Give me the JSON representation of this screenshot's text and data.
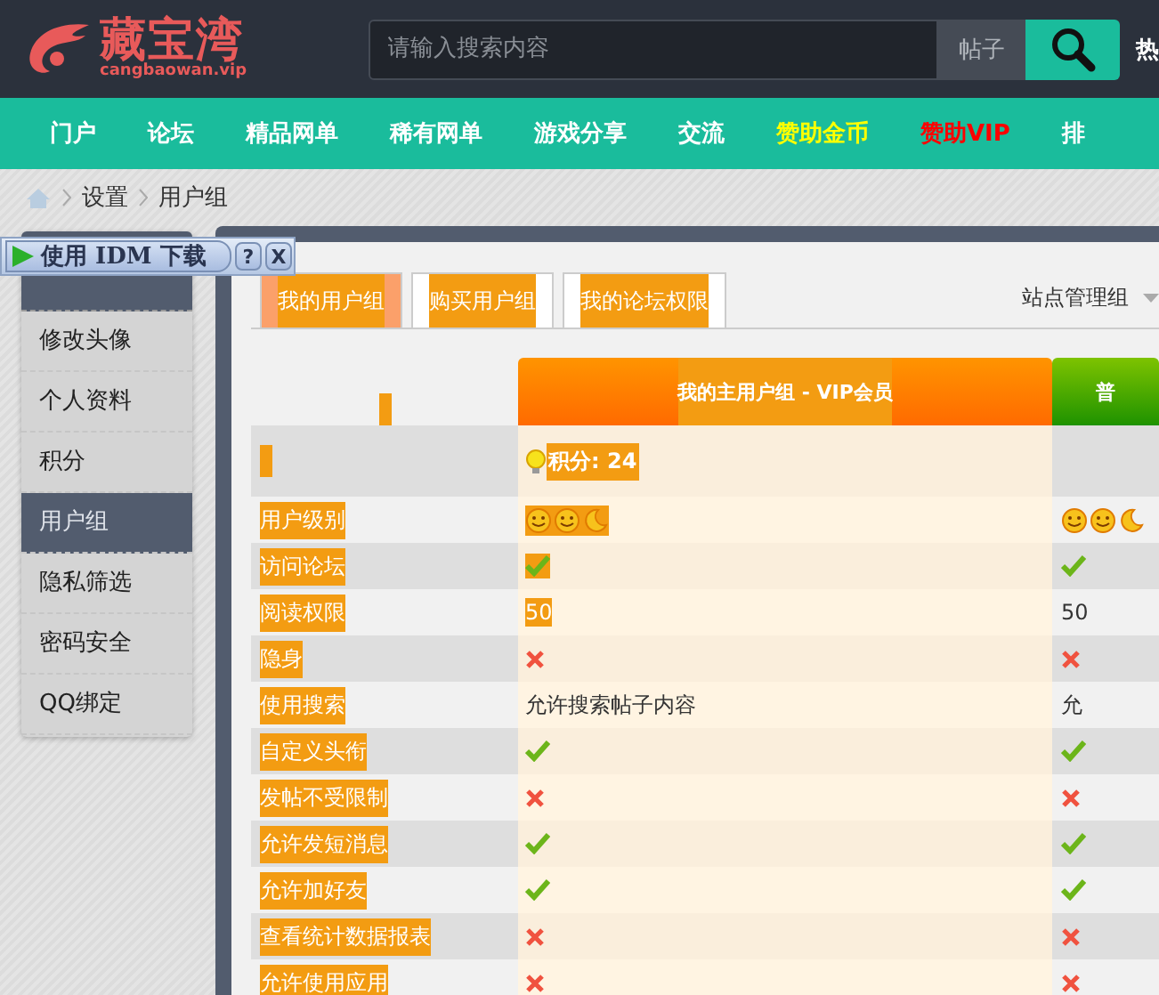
{
  "header": {
    "logo_text": "藏宝湾",
    "logo_domain": "cangbaowan.vip",
    "search": {
      "placeholder": "请输入搜索内容"
    },
    "search_scope": "帖子",
    "hot_label": "热"
  },
  "nav": [
    {
      "label": "门户",
      "kind": "normal"
    },
    {
      "label": "论坛",
      "kind": "normal"
    },
    {
      "label": "精品网单",
      "kind": "normal"
    },
    {
      "label": "稀有网单",
      "kind": "normal"
    },
    {
      "label": "游戏分享",
      "kind": "normal"
    },
    {
      "label": "交流",
      "kind": "normal"
    },
    {
      "label": "赞助金币",
      "kind": "gold"
    },
    {
      "label": "赞助VIP",
      "kind": "vip"
    },
    {
      "label": "排",
      "kind": "normal"
    }
  ],
  "breadcrumb": [
    "设置",
    "用户组"
  ],
  "idm_bar": {
    "label": "使用 IDM 下载",
    "help": "?",
    "close": "X"
  },
  "sidebar": {
    "items": [
      {
        "label": "修改头像",
        "selected": false
      },
      {
        "label": "个人资料",
        "selected": false
      },
      {
        "label": "积分",
        "selected": false
      },
      {
        "label": "用户组",
        "selected": true
      },
      {
        "label": "隐私筛选",
        "selected": false
      },
      {
        "label": "密码安全",
        "selected": false
      },
      {
        "label": "QQ绑定",
        "selected": false
      }
    ]
  },
  "tabs": [
    {
      "label": "我的用户组",
      "selected": true
    },
    {
      "label": "购买用户组",
      "selected": false
    },
    {
      "label": "我的论坛权限",
      "selected": false
    }
  ],
  "group_select": "站点管理组",
  "table": {
    "columns": [
      {
        "label": "我的主用户组 - VIP会员",
        "kind": "vip"
      },
      {
        "label": "普",
        "kind": "normal"
      }
    ],
    "score": "积分: 24",
    "rows": [
      {
        "label": "用户级别",
        "cells": [
          {
            "kind": "smileys",
            "highlighted": true
          },
          {
            "kind": "smileys",
            "highlighted": false
          }
        ]
      },
      {
        "label": "访问论坛",
        "cells": [
          {
            "kind": "check",
            "highlighted": true
          },
          {
            "kind": "check",
            "highlighted": false
          }
        ]
      },
      {
        "label": "阅读权限",
        "cells": [
          {
            "kind": "text",
            "text": "50",
            "highlighted": true
          },
          {
            "kind": "text",
            "text": "50",
            "highlighted": false
          }
        ]
      },
      {
        "label": "隐身",
        "cells": [
          {
            "kind": "cross",
            "highlighted": false
          },
          {
            "kind": "cross",
            "highlighted": false
          }
        ]
      },
      {
        "label": "使用搜索",
        "cells": [
          {
            "kind": "text",
            "text": "允许搜索帖子内容",
            "highlighted": false
          },
          {
            "kind": "text",
            "text": "允",
            "highlighted": false
          }
        ]
      },
      {
        "label": "自定义头衔",
        "cells": [
          {
            "kind": "check",
            "highlighted": false
          },
          {
            "kind": "check",
            "highlighted": false
          }
        ]
      },
      {
        "label": "发帖不受限制",
        "cells": [
          {
            "kind": "cross",
            "highlighted": false
          },
          {
            "kind": "cross",
            "highlighted": false
          }
        ]
      },
      {
        "label": "允许发短消息",
        "cells": [
          {
            "kind": "check",
            "highlighted": false
          },
          {
            "kind": "check",
            "highlighted": false
          }
        ]
      },
      {
        "label": "允许加好友",
        "cells": [
          {
            "kind": "check",
            "highlighted": false
          },
          {
            "kind": "check",
            "highlighted": false
          }
        ]
      },
      {
        "label": "查看统计数据报表",
        "cells": [
          {
            "kind": "cross",
            "highlighted": false
          },
          {
            "kind": "cross",
            "highlighted": false
          }
        ]
      },
      {
        "label": "允许使用应用",
        "cells": [
          {
            "kind": "cross",
            "highlighted": false
          },
          {
            "kind": "cross",
            "highlighted": false
          }
        ]
      }
    ]
  }
}
